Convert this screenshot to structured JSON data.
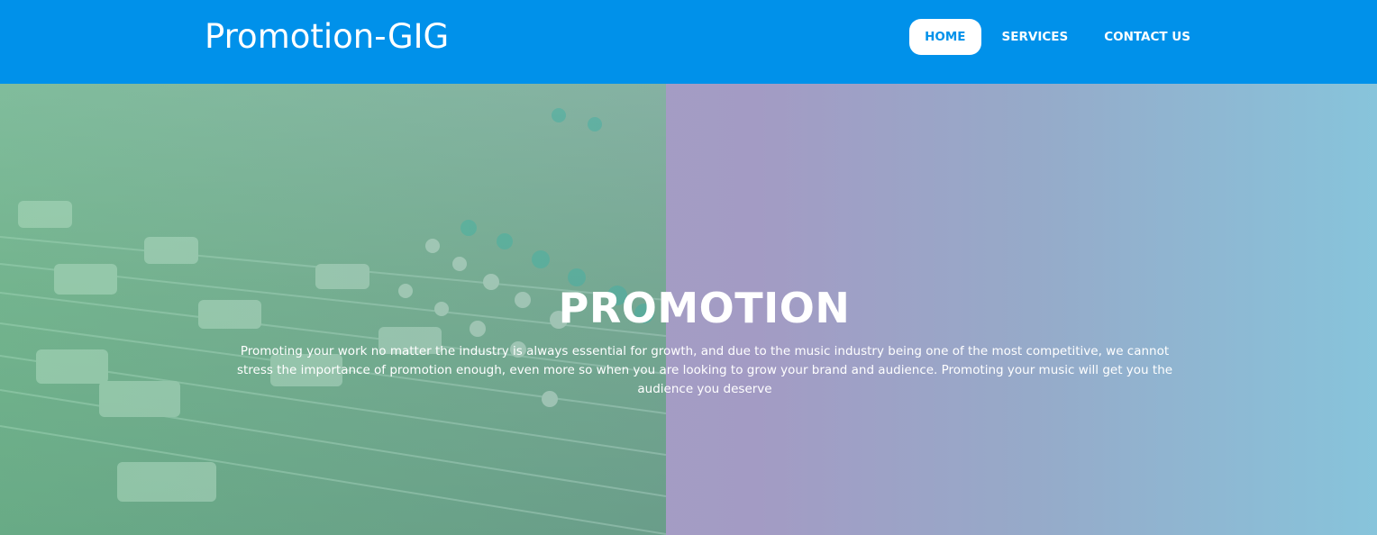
{
  "navbar": {
    "brand": "Promotion-GIG",
    "items": [
      {
        "label": "HOME",
        "active": true
      },
      {
        "label": "SERVICES",
        "active": false
      },
      {
        "label": "CONTACT US",
        "active": false
      }
    ]
  },
  "hero": {
    "title": "PROMOTION",
    "text": "Promoting your work no matter the industry is always essential for growth, and due to the music industry being one of the most competitive, we cannot stress the importance of promotion enough, even more so when you are looking to grow your brand and audience. Promoting your music will get you the audience you deserve"
  },
  "colors": {
    "navbar_bg": "#0091ea",
    "active_pill_bg": "#ffffff",
    "active_pill_text": "#0091ea",
    "hero_overlay_left": "#7fb89d",
    "hero_overlay_right": "#87c4db"
  }
}
